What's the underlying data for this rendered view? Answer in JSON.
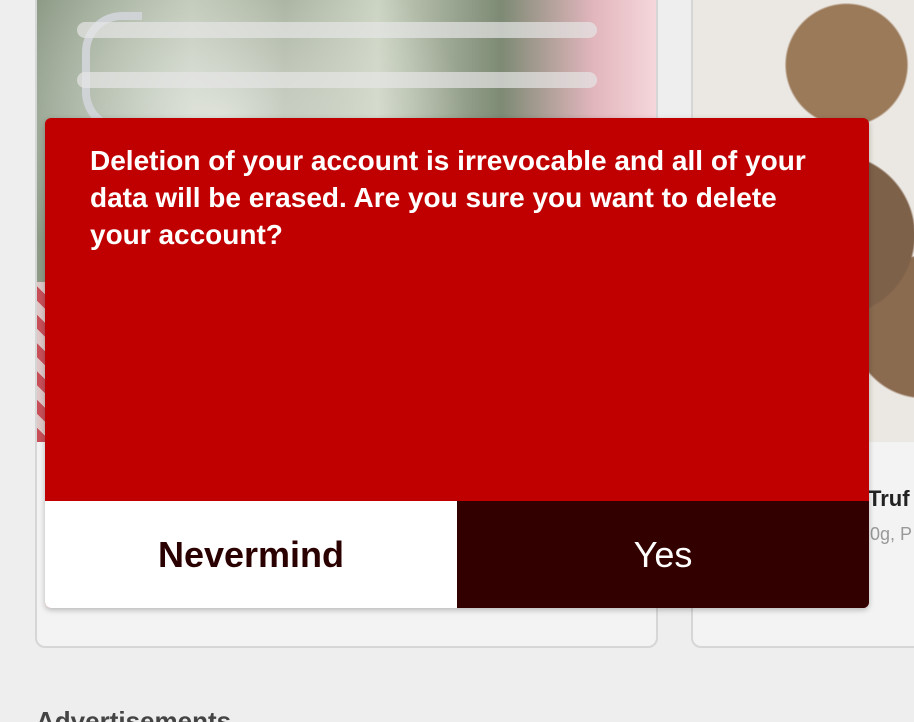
{
  "background": {
    "right_card": {
      "title": "Truf",
      "subtitle": "0g, P"
    },
    "section_heading": "Advertisements"
  },
  "dialog": {
    "message": "Deletion of your account is irrevocable and all of your data will be erased. Are you sure you want to delete your account?",
    "cancel_label": "Nevermind",
    "confirm_label": "Yes"
  },
  "colors": {
    "dialog_background": "#c00000",
    "confirm_button": "#330000",
    "cancel_button": "#ffffff"
  }
}
